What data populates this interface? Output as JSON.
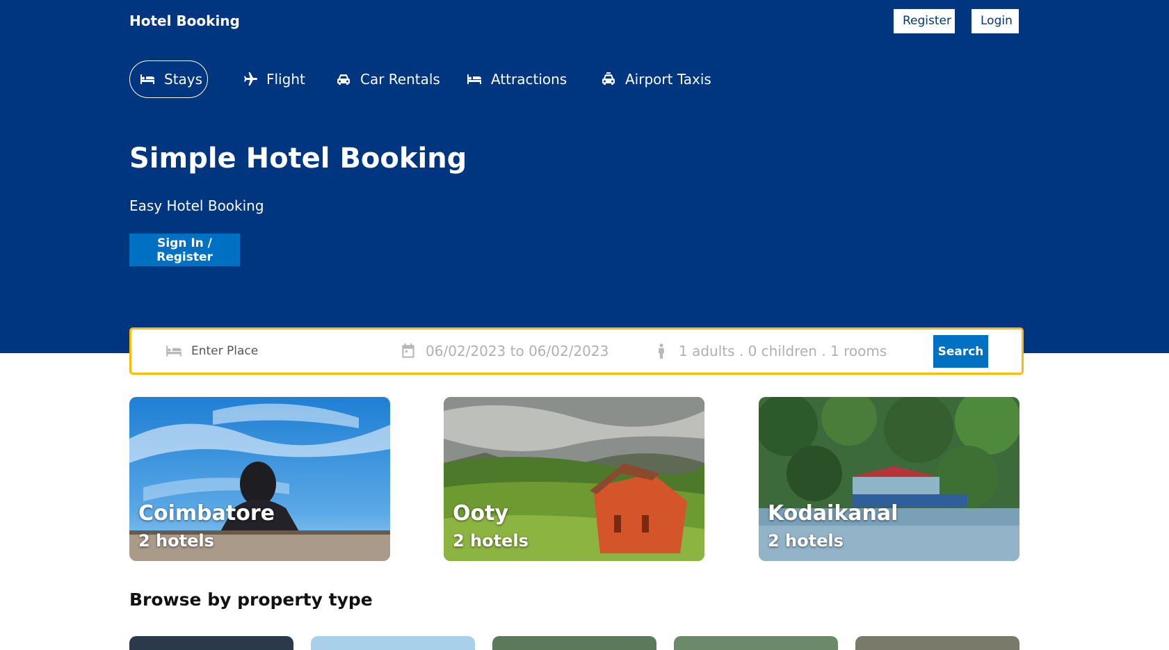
{
  "header": {
    "logo": "Hotel Booking",
    "register_label": "Register",
    "login_label": "Login"
  },
  "nav": {
    "items": [
      {
        "label": "Stays",
        "icon": "bed-icon",
        "active": true
      },
      {
        "label": "Flight",
        "icon": "plane-icon",
        "active": false
      },
      {
        "label": "Car Rentals",
        "icon": "car-icon",
        "active": false
      },
      {
        "label": "Attractions",
        "icon": "bed-icon",
        "active": false
      },
      {
        "label": "Airport Taxis",
        "icon": "taxi-icon",
        "active": false
      }
    ]
  },
  "hero": {
    "title": "Simple Hotel Booking",
    "subtitle": "Easy Hotel Booking",
    "signin_label": "Sign In / Register"
  },
  "search": {
    "place_placeholder": "Enter Place",
    "dates": "06/02/2023 to 06/02/2023",
    "guests": "1 adults . 0 children . 1 rooms",
    "button_label": "Search"
  },
  "cities": [
    {
      "name": "Coimbatore",
      "count": "2 hotels"
    },
    {
      "name": "Ooty",
      "count": "2 hotels"
    },
    {
      "name": "Kodaikanal",
      "count": "2 hotels"
    }
  ],
  "property_section": {
    "title": "Browse by property type"
  },
  "colors": {
    "brand": "#003580",
    "accent": "#0071c2",
    "search_border": "#febb02"
  }
}
